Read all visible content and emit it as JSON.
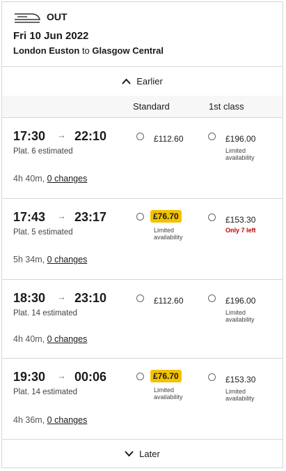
{
  "header": {
    "direction": "OUT",
    "date": "Fri 10 Jun 2022",
    "origin": "London Euston",
    "connector": "to",
    "destination": "Glasgow Central"
  },
  "earlier_label": "Earlier",
  "later_label": "Later",
  "columns": {
    "standard": "Standard",
    "first_class": "1st class"
  },
  "journeys": [
    {
      "depart": "17:30",
      "arrive": "22:10",
      "platform": "Plat. 6 estimated",
      "duration": "4h 40m,",
      "changes": "0 changes",
      "standard": {
        "price": "£112.60",
        "cheapest": false,
        "note": ""
      },
      "first": {
        "price": "£196.00",
        "note": "Limited availability",
        "alert": false
      }
    },
    {
      "depart": "17:43",
      "arrive": "23:17",
      "platform": "Plat. 5 estimated",
      "duration": "5h 34m,",
      "changes": "0 changes",
      "standard": {
        "price": "£76.70",
        "cheapest": true,
        "note": "Limited availability"
      },
      "first": {
        "price": "£153.30",
        "note": "Only 7 left",
        "alert": true
      }
    },
    {
      "depart": "18:30",
      "arrive": "23:10",
      "platform": "Plat. 14 estimated",
      "duration": "4h 40m,",
      "changes": "0 changes",
      "standard": {
        "price": "£112.60",
        "cheapest": false,
        "note": ""
      },
      "first": {
        "price": "£196.00",
        "note": "Limited availability",
        "alert": false
      }
    },
    {
      "depart": "19:30",
      "arrive": "00:06",
      "platform": "Plat. 14 estimated",
      "duration": "4h 36m,",
      "changes": "0 changes",
      "standard": {
        "price": "£76.70",
        "cheapest": true,
        "note": "Limited availability"
      },
      "first": {
        "price": "£153.30",
        "note": "Limited availability",
        "alert": false
      }
    }
  ],
  "colors": {
    "cheapest_badge": "#f3c200",
    "alert_text": "#c00000",
    "divider": "#d6d6d6"
  }
}
